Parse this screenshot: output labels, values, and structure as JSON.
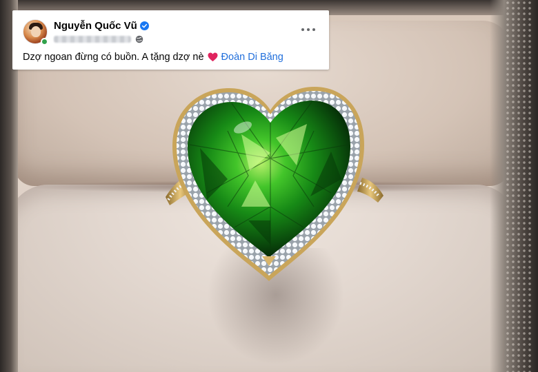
{
  "post": {
    "author_name": "Nguyễn Quốc Vũ",
    "verified": true,
    "online": true,
    "audience_icon": "globe-icon",
    "more_icon": "more-horizontal-icon",
    "text": "Dzợ ngoan đừng có buồn. A tặng dzợ nè",
    "emoji": "heart-icon",
    "mention": "Đoàn Di Băng",
    "colors": {
      "mention": "#216fdb",
      "verified": "#1877f2",
      "online": "#31a24c",
      "heart": "#e0245e"
    }
  },
  "photo": {
    "subject": "heart-shaped green gemstone ring with diamond halo in a velvet ring box",
    "colors": {
      "gem": "#1f8a1c",
      "halo": "#e9eef2",
      "band": "#c9a55a",
      "velvet": "#e2d6cd"
    }
  }
}
